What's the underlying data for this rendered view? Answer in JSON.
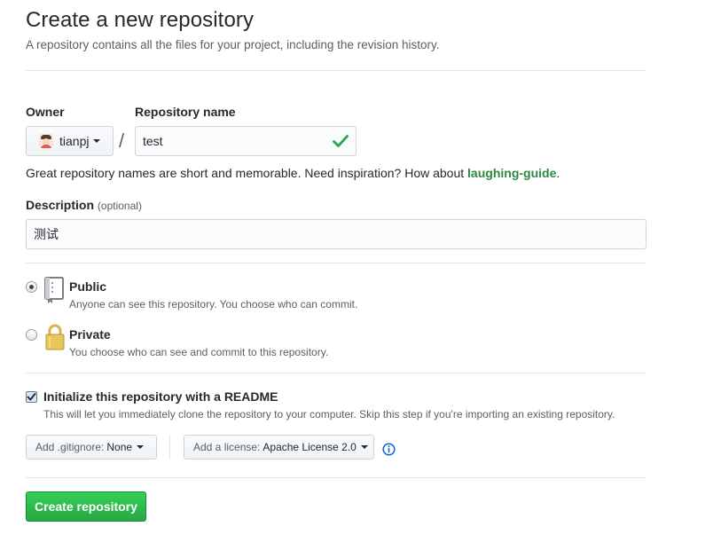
{
  "header": {
    "title": "Create a new repository",
    "subtitle": "A repository contains all the files for your project, including the revision history."
  },
  "owner": {
    "label": "Owner",
    "name": "tianpj"
  },
  "separator": "/",
  "repository": {
    "label": "Repository name",
    "value": "test",
    "valid": true
  },
  "hint": {
    "text": "Great repository names are short and memorable. Need inspiration? How about ",
    "suggestion": "laughing-guide",
    "suffix": "."
  },
  "description": {
    "label": "Description",
    "optional": "(optional)",
    "value": "测试"
  },
  "visibility": {
    "public": {
      "title": "Public",
      "note": "Anyone can see this repository. You choose who can commit.",
      "selected": true
    },
    "private": {
      "title": "Private",
      "note": "You choose who can see and commit to this repository.",
      "selected": false
    }
  },
  "readme": {
    "checked": true,
    "label": "Initialize this repository with a README",
    "note": "This will let you immediately clone the repository to your computer. Skip this step if you're importing an existing repository."
  },
  "gitignore": {
    "prefix": "Add .gitignore:",
    "value": "None"
  },
  "license": {
    "prefix": "Add a license:",
    "value": "Apache License 2.0"
  },
  "submit": {
    "label": "Create repository"
  },
  "colors": {
    "accent": "#28a745",
    "info": "#0366d6",
    "check": "#28a745"
  },
  "icons": {
    "owner_avatar": "avatar",
    "repo_valid": "check-icon",
    "public": "repo-book-icon",
    "private": "lock-icon",
    "license_info": "info-icon"
  }
}
